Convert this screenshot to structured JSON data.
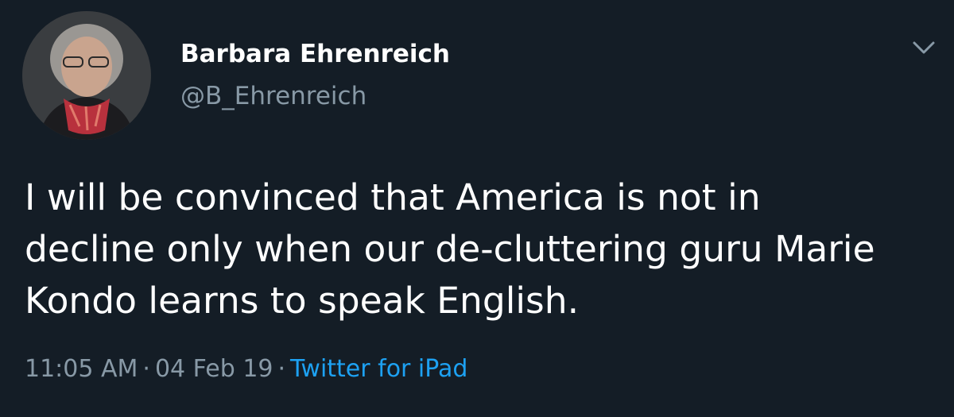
{
  "author": {
    "display_name": "Barbara Ehrenreich",
    "handle": "@B_Ehrenreich",
    "avatar_icon": "profile-photo"
  },
  "tweet": {
    "lines": [
      "I will be convinced that America is not in",
      "decline only when our de-cluttering guru Marie",
      "Kondo learns to speak English."
    ]
  },
  "meta": {
    "time": "11:05 AM",
    "separator": "·",
    "date": "04 Feb 19",
    "source": "Twitter for iPad"
  },
  "menu": {
    "icon": "chevron-down-icon"
  },
  "colors": {
    "background": "#141d26",
    "primary_text": "#ffffff",
    "secondary_text": "#8899a6",
    "link": "#1da1f2"
  }
}
